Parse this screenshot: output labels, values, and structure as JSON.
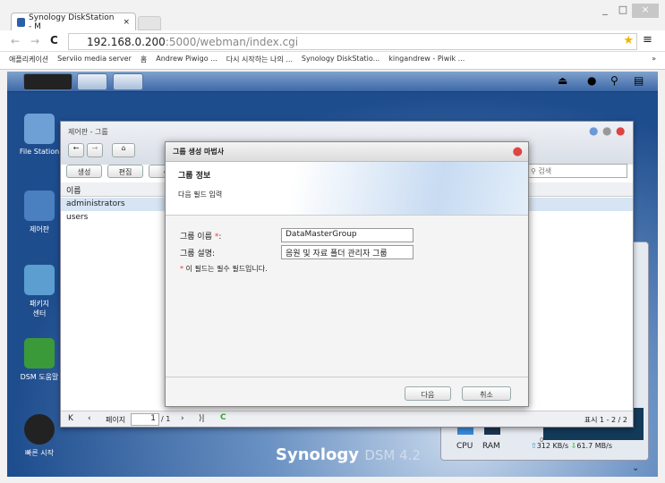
{
  "browser": {
    "tab_title": "Synology DiskStation - M",
    "url_host": "192.168.0.200",
    "url_rest": ":5000/webman/index.cgi",
    "bookmarks": [
      "애플리케이션",
      "Serviio media server",
      "홈",
      "Andrew Piwigo ...",
      "다시 시작하는 나의 ...",
      "Synology DiskStatio...",
      "kingandrew - Piwik ..."
    ],
    "more": "»"
  },
  "desktop": {
    "icons": [
      "File Station",
      "제어판",
      "패키지\n센터",
      "DSM 도움말",
      "빠른 시작"
    ],
    "brand": "Synology",
    "version": "DSM 4.2"
  },
  "window": {
    "title": "제어판 - 그룹",
    "toolbar": [
      "생성",
      "편집",
      "삭"
    ],
    "search_placeholder": "검색",
    "column": "이름",
    "rows": [
      "administrators",
      "users"
    ],
    "pager": {
      "page_label": "페이지",
      "page": "1",
      "total": "/ 1",
      "display": "표시 1 - 2 / 2"
    }
  },
  "dialog": {
    "title": "그룹 생성 마법사",
    "section": "그룹 정보",
    "subtitle": "다음 필드 입력",
    "name_label": "그룹 이름 ",
    "required_mark": "*",
    "colon": ":",
    "name_value": "DataMasterGroup",
    "desc_label": "그룹 설명:",
    "desc_value": "음원 및 자료 폴더 관리자 그룹",
    "required_note": "이 필드는 필수 필드입니다.",
    "next": "다음",
    "cancel": "취소"
  },
  "widget": {
    "cpu": "CPU",
    "ram": "RAM",
    "upload": "312 KB/s",
    "download": "61.7 MB/s",
    "axis_zero": "0"
  }
}
